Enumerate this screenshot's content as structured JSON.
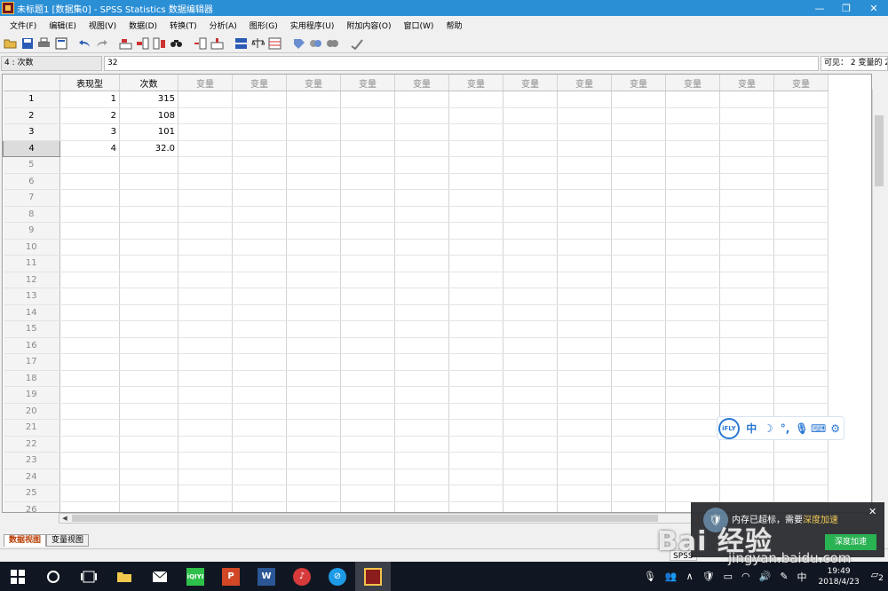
{
  "window": {
    "title": "未标题1 [数据集0] - SPSS Statistics 数据编辑器"
  },
  "menu": [
    "文件(F)",
    "编辑(E)",
    "视图(V)",
    "数据(D)",
    "转换(T)",
    "分析(A)",
    "图形(G)",
    "实用程序(U)",
    "附加内容(O)",
    "窗口(W)",
    "帮助"
  ],
  "refbar": {
    "cell_ref": "4 : 次数",
    "cell_value": "32",
    "visible": "可见： 2 变量的 2"
  },
  "grid": {
    "columns": [
      "表现型",
      "次数"
    ],
    "empty_var_label": "变量",
    "rows": [
      {
        "n": "1",
        "a": "1",
        "b": "315"
      },
      {
        "n": "2",
        "a": "2",
        "b": "108"
      },
      {
        "n": "3",
        "a": "3",
        "b": "101"
      },
      {
        "n": "4",
        "a": "4",
        "b": "32.0"
      }
    ],
    "empty_rows": [
      "5",
      "6",
      "7",
      "8",
      "9",
      "10",
      "11",
      "12",
      "13",
      "14",
      "15",
      "16",
      "17",
      "18",
      "19",
      "20",
      "21",
      "22",
      "23",
      "24",
      "25",
      "26"
    ]
  },
  "tabs": {
    "data_view": "数据视图",
    "variable_view": "变量视图"
  },
  "status": {
    "processor": "SPSS"
  },
  "ime": {
    "brand": "iFLY",
    "mode": "中"
  },
  "popup": {
    "message_a": "内存已超标，需要",
    "message_b": "深度加速",
    "button": "深度加速"
  },
  "watermark": {
    "line1": "Bai 经验",
    "line2": "jingyan.baidu.com"
  },
  "taskbar": {
    "time": "19:49",
    "date": "2018/4/23",
    "notification_count": "2"
  }
}
